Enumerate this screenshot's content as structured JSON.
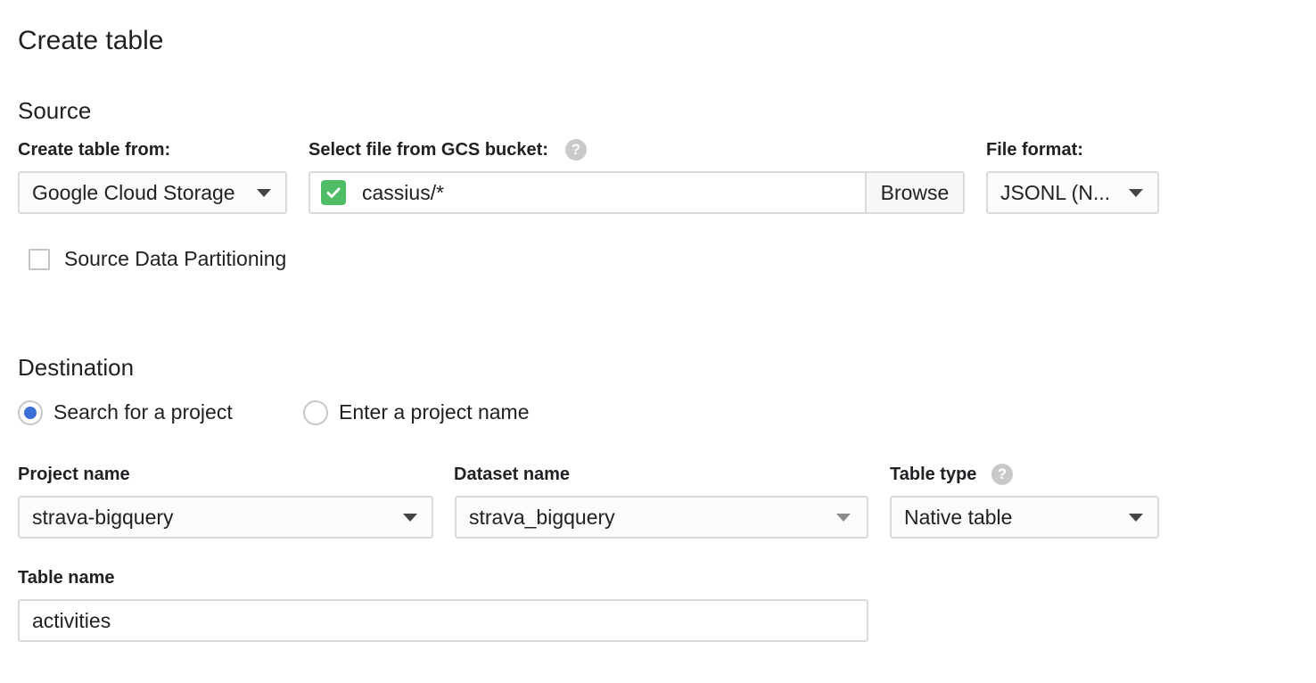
{
  "page": {
    "title": "Create table"
  },
  "source": {
    "heading": "Source",
    "create_from": {
      "label": "Create table from:",
      "value": "Google Cloud Storage"
    },
    "gcs_file": {
      "label": "Select file from GCS bucket:",
      "help_glyph": "?",
      "value": "cassius/*",
      "status_icon": "check-icon",
      "browse_label": "Browse"
    },
    "file_format": {
      "label": "File format:",
      "value": "JSONL (N..."
    },
    "partitioning": {
      "label": "Source Data Partitioning",
      "checked": false
    }
  },
  "destination": {
    "heading": "Destination",
    "project_mode": [
      {
        "label": "Search for a project",
        "selected": true
      },
      {
        "label": "Enter a project name",
        "selected": false
      }
    ],
    "project_name": {
      "label": "Project name",
      "value": "strava-bigquery"
    },
    "dataset_name": {
      "label": "Dataset name",
      "value": "strava_bigquery"
    },
    "table_type": {
      "label": "Table type",
      "help_glyph": "?",
      "value": "Native table"
    },
    "table_name": {
      "label": "Table name",
      "value": "activities"
    }
  },
  "colors": {
    "accent": "#3b6fd6",
    "success": "#4ebd66",
    "border": "#dadada"
  }
}
